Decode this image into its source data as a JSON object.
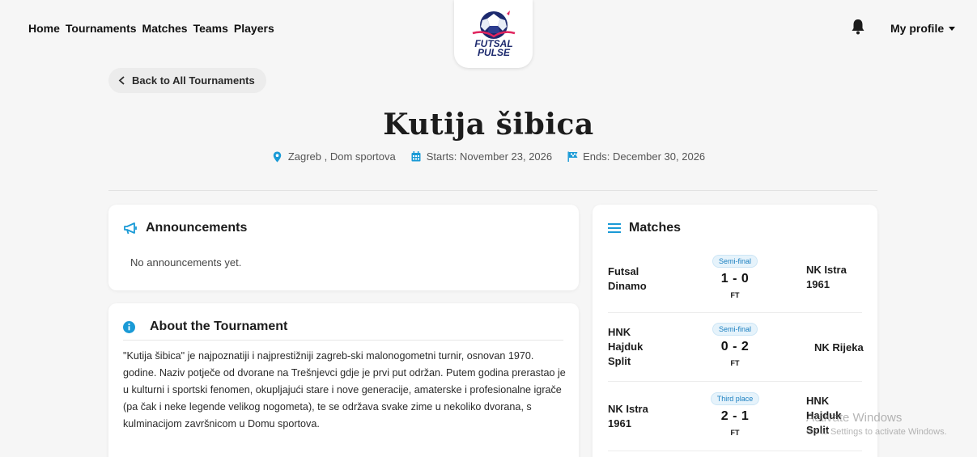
{
  "nav": {
    "links": [
      "Home",
      "Tournaments",
      "Matches",
      "Teams",
      "Players"
    ],
    "logo_text_line1": "FUTSAL",
    "logo_text_line2": "PULSE",
    "profile_label": "My profile",
    "bell_icon": "bell-icon"
  },
  "page": {
    "back_label": "Back to All Tournaments",
    "title": "Kutija šibica",
    "location": "Zagreb , Dom sportova",
    "starts": "Starts: November 23, 2026",
    "ends": "Ends: December 30, 2026"
  },
  "announcements": {
    "heading": "Announcements",
    "empty": "No announcements yet."
  },
  "about": {
    "heading": "About the Tournament",
    "text": "\"Kutija šibica\" je najpoznatiji i najprestižniji zagreb-ski malonogometni turnir, osnovan 1970. godine. Naziv potječe od dvorane na Trešnjevci gdje je prvi put održan. Putem godina prerastao je u kulturni i sportski fenomen, okupljajući stare i nove generacije, amaterske i profesionalne igrače (pa čak i neke legende velikog nogometa), te se održava svake zime u nekoliko dvorana, s kulminacijom završnicom u Domu sportova."
  },
  "matches": {
    "heading": "Matches",
    "items": [
      {
        "stage": "Semi-final",
        "home": "Futsal Dinamo",
        "score": "1 - 0",
        "status": "FT",
        "away": "NK Istra 1961"
      },
      {
        "stage": "Semi-final",
        "home": "HNK Hajduk Split",
        "score": "0 - 2",
        "status": "FT",
        "away": "NK Rijeka"
      },
      {
        "stage": "Third place",
        "home": "NK Istra 1961",
        "score": "2 - 1",
        "status": "FT",
        "away": "HNK Hajduk Split"
      }
    ]
  },
  "watermark": {
    "line1": "Activate Windows",
    "line2": "Go to Settings to activate Windows."
  },
  "colors": {
    "accent": "#1a9ad6",
    "text": "#1c1c1c",
    "background": "#f6f6f6"
  }
}
